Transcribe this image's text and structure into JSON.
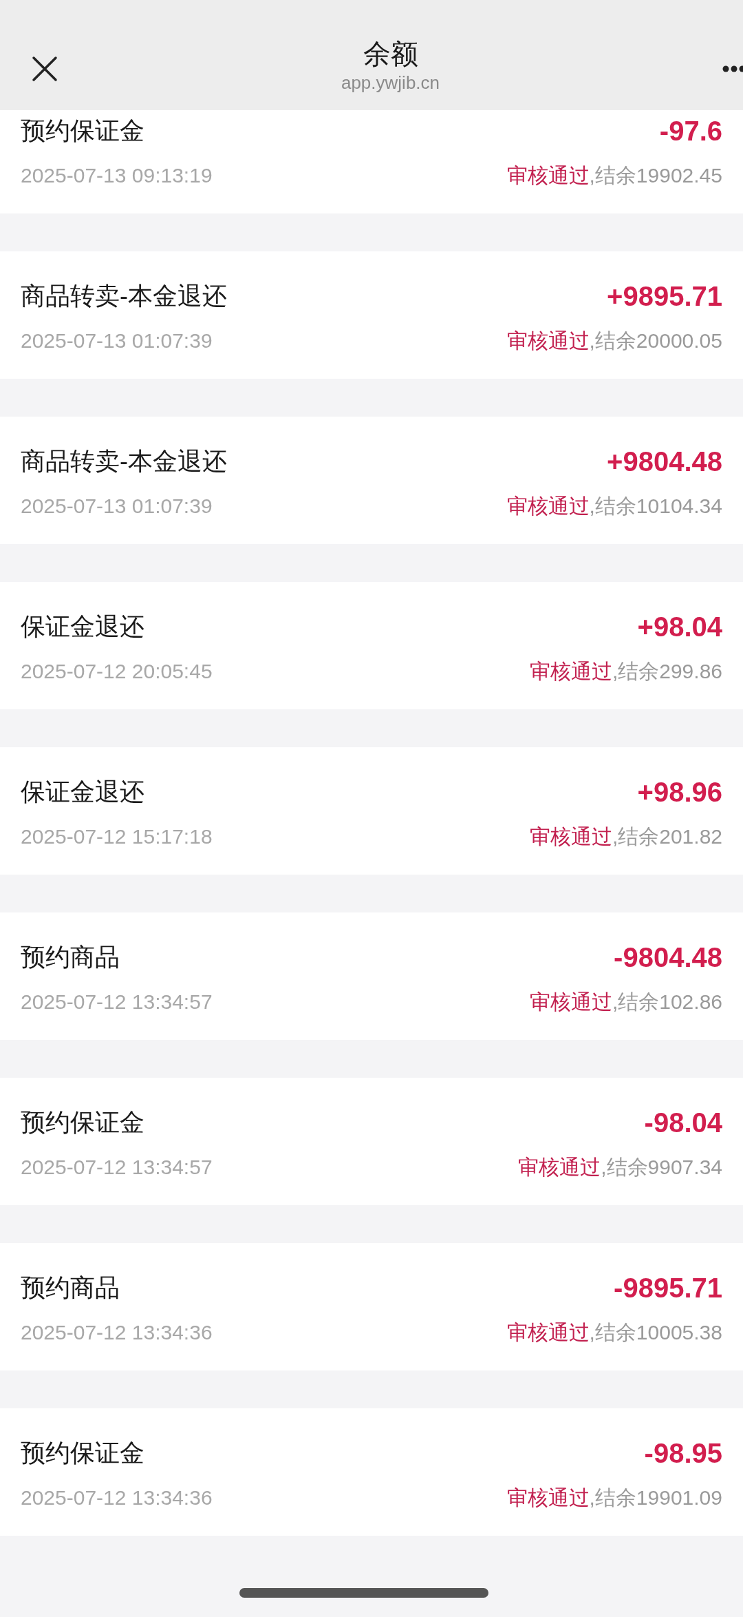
{
  "header": {
    "title": "余额",
    "subtitle": "app.ywjib.cn"
  },
  "records": [
    {
      "title": "预约保证金",
      "amount": "-97.6",
      "datetime": "2025-07-13 09:13:19",
      "status": "审核通过",
      "balance": ",结余19902.45"
    },
    {
      "title": "商品转卖-本金退还",
      "amount": "+9895.71",
      "datetime": "2025-07-13 01:07:39",
      "status": "审核通过",
      "balance": ",结余20000.05"
    },
    {
      "title": "商品转卖-本金退还",
      "amount": "+9804.48",
      "datetime": "2025-07-13 01:07:39",
      "status": "审核通过",
      "balance": ",结余10104.34"
    },
    {
      "title": "保证金退还",
      "amount": "+98.04",
      "datetime": "2025-07-12 20:05:45",
      "status": "审核通过",
      "balance": ",结余299.86"
    },
    {
      "title": "保证金退还",
      "amount": "+98.96",
      "datetime": "2025-07-12 15:17:18",
      "status": "审核通过",
      "balance": ",结余201.82"
    },
    {
      "title": "预约商品",
      "amount": "-9804.48",
      "datetime": "2025-07-12 13:34:57",
      "status": "审核通过",
      "balance": ",结余102.86"
    },
    {
      "title": "预约保证金",
      "amount": "-98.04",
      "datetime": "2025-07-12 13:34:57",
      "status": "审核通过",
      "balance": ",结余9907.34"
    },
    {
      "title": "预约商品",
      "amount": "-9895.71",
      "datetime": "2025-07-12 13:34:36",
      "status": "审核通过",
      "balance": ",结余10005.38"
    },
    {
      "title": "预约保证金",
      "amount": "-98.95",
      "datetime": "2025-07-12 13:34:36",
      "status": "审核通过",
      "balance": ",结余19901.09"
    }
  ]
}
